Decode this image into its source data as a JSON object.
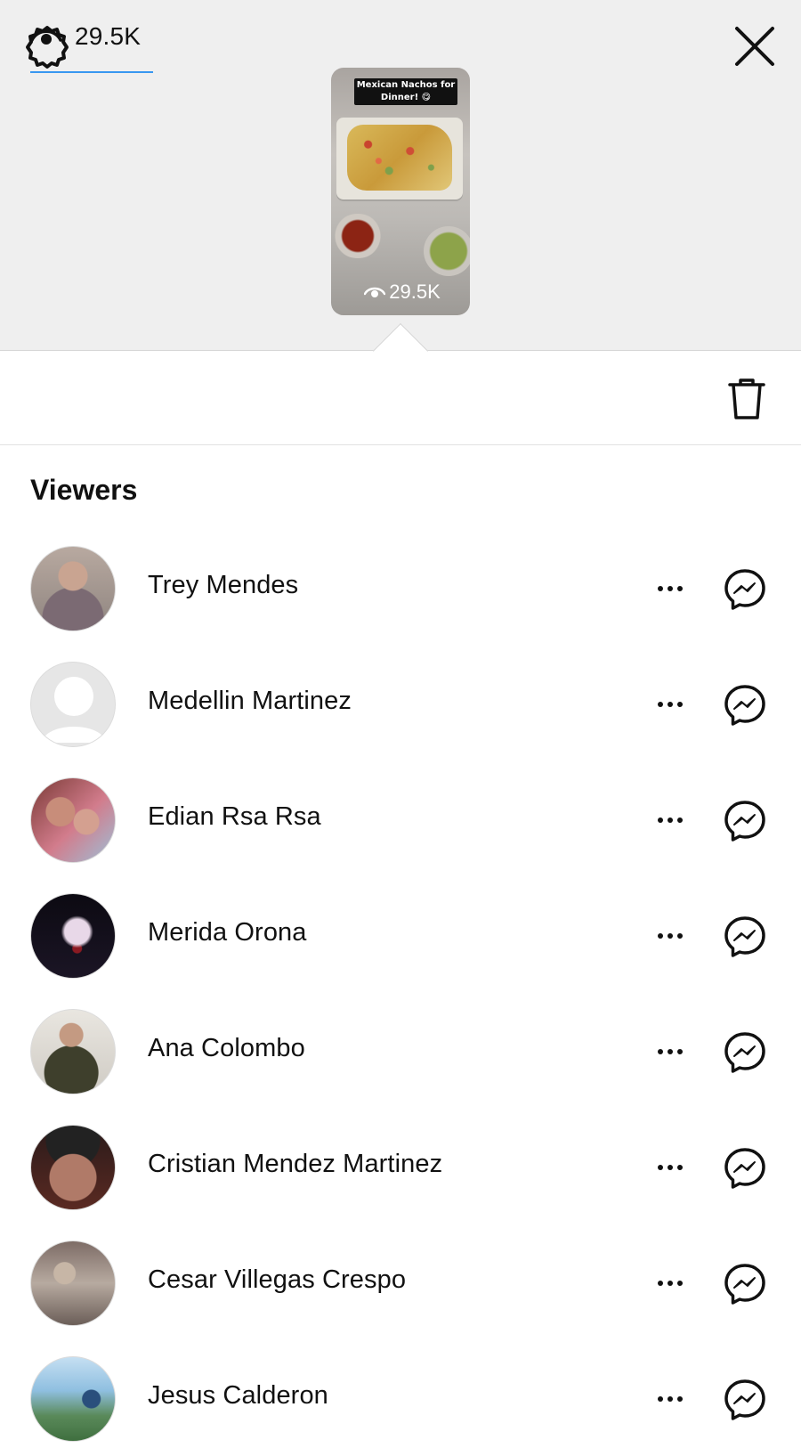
{
  "story": {
    "caption": "Mexican Nachos for Dinner! 😋",
    "views": "29.5K"
  },
  "stats": {
    "view_count": "29.5K"
  },
  "section_title": "Viewers",
  "viewers": [
    {
      "name": "Trey Mendes"
    },
    {
      "name": "Medellin Martinez"
    },
    {
      "name": "Edian Rsa Rsa"
    },
    {
      "name": "Merida Orona"
    },
    {
      "name": "Ana Colombo"
    },
    {
      "name": "Cristian Mendez Martinez"
    },
    {
      "name": "Cesar Villegas Crespo"
    },
    {
      "name": "Jesus Calderon"
    }
  ],
  "icons": {
    "settings": "settings-gear-icon",
    "close": "close-icon",
    "eye": "eye-icon",
    "delete": "trash-icon",
    "more": "more-horizontal-icon",
    "message": "messenger-icon"
  },
  "colors": {
    "accent": "#3897f0",
    "header_bg": "#efefef"
  }
}
